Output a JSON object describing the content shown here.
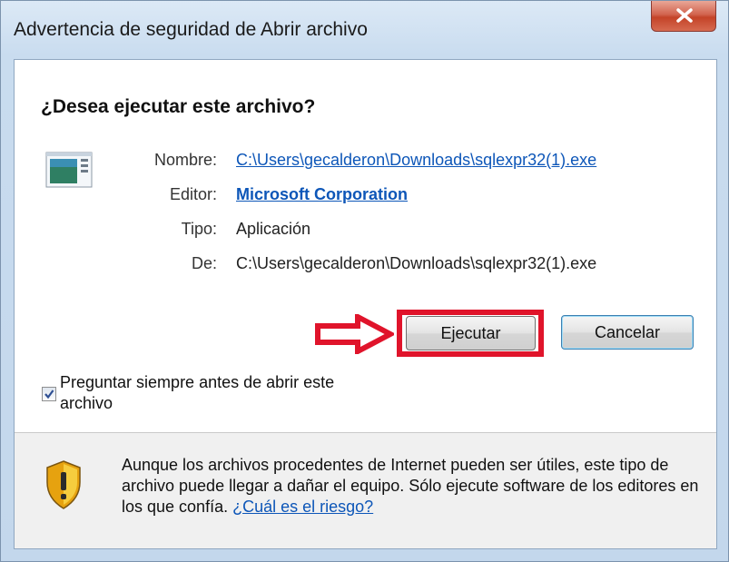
{
  "window": {
    "title": "Advertencia de seguridad de Abrir archivo"
  },
  "dialog": {
    "question": "¿Desea ejecutar este archivo?",
    "fields": {
      "nombre_label": "Nombre:",
      "nombre_value": "C:\\Users\\gecalderon\\Downloads\\sqlexpr32(1).exe",
      "editor_label": "Editor:",
      "editor_value": "Microsoft Corporation",
      "tipo_label": "Tipo:",
      "tipo_value": "Aplicación",
      "de_label": "De:",
      "de_value": "C:\\Users\\gecalderon\\Downloads\\sqlexpr32(1).exe"
    },
    "buttons": {
      "run": "Ejecutar",
      "cancel": "Cancelar"
    },
    "checkbox": {
      "label": "Preguntar siempre antes de abrir este archivo",
      "checked": true
    },
    "warning": {
      "text": "Aunque los archivos procedentes de Internet pueden ser útiles, este tipo de archivo puede llegar a dañar el equipo. Sólo ejecute software de los editores en los que confía.",
      "link": "¿Cuál es el riesgo?"
    }
  },
  "colors": {
    "highlight": "#e0142b",
    "link": "#0d56b8"
  },
  "icons": [
    "close-icon",
    "application-file-icon",
    "red-arrow-icon",
    "checkmark-icon",
    "warning-shield-icon"
  ]
}
